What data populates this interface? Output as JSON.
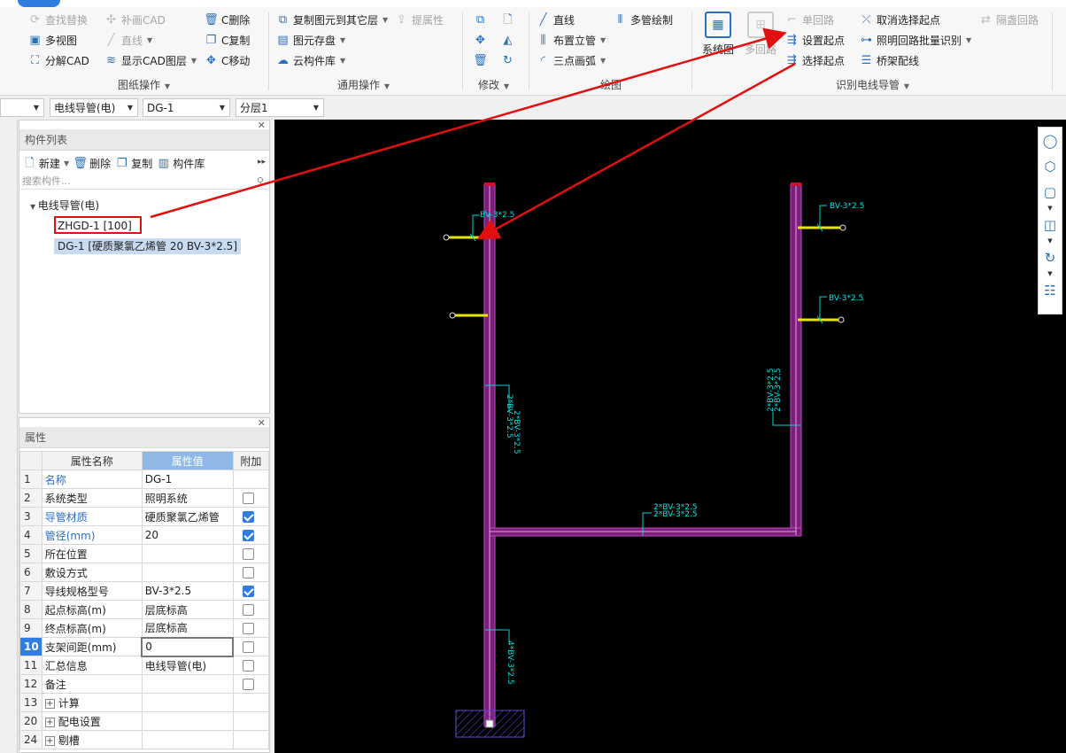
{
  "ribbon": {
    "c1": {
      "find_replace": "查找替换",
      "multi_view": "多视图",
      "explode_cad": "分解CAD"
    },
    "c2": {
      "patch_cad": "补画CAD",
      "line": "直线",
      "show_cad_layer": "显示CAD图层"
    },
    "c3": {
      "c_delete": "C删除",
      "c_copy": "C复制",
      "c_move": "C移动"
    },
    "group_drawing_ops": "图纸操作",
    "c4": {
      "copy_to_other_floor": "复制图元到其它层",
      "extract_attr": "提属性",
      "elem_save": "图元存盘",
      "cloud_lib": "云构件库"
    },
    "group_general_ops": "通用操作",
    "group_modify": "修改",
    "c6": {
      "line": "直线",
      "riser": "布置立管",
      "arc3": "三点画弧",
      "multi_pipe": "多管绘制"
    },
    "group_draw": "绘图",
    "c7": {
      "system_diagram": "系统图",
      "multi_loop": "多回路",
      "single_loop": "单回路",
      "set_start": "设置起点",
      "select_start": "选择起点",
      "cancel_select_start": "取消选择起点",
      "batch_identify": "照明回路批量识别",
      "tray_wire": "桥架配线",
      "floor_loop": "隔盏回路"
    },
    "group_identify": "识别电线导管"
  },
  "selectors": {
    "type": "电线导管(电)",
    "name": "DG-1",
    "layer": "分层1"
  },
  "component_list": {
    "title": "构件列表",
    "toolbar": {
      "new": "新建",
      "delete": "删除",
      "copy": "复制",
      "library": "构件库"
    },
    "search_placeholder": "搜索构件...",
    "tree_root": "电线导管(电)",
    "items": [
      "ZHGD-1 [100]",
      "DG-1 [硬质聚氯乙烯管 20 BV-3*2.5]"
    ]
  },
  "properties": {
    "title": "属性",
    "headers": [
      "属性名称",
      "属性值",
      "附加"
    ],
    "rows": [
      {
        "num": "1",
        "name": "名称",
        "value": "DG-1",
        "check": "none",
        "blue": true
      },
      {
        "num": "2",
        "name": "系统类型",
        "value": "照明系统",
        "check": "off",
        "blue": false
      },
      {
        "num": "3",
        "name": "导管材质",
        "value": "硬质聚氯乙烯管",
        "check": "on",
        "blue": true
      },
      {
        "num": "4",
        "name": "管径(mm)",
        "value": "20",
        "check": "on",
        "blue": true
      },
      {
        "num": "5",
        "name": "所在位置",
        "value": "",
        "check": "off",
        "blue": false
      },
      {
        "num": "6",
        "name": "敷设方式",
        "value": "",
        "check": "off",
        "blue": false
      },
      {
        "num": "7",
        "name": "导线规格型号",
        "value": "BV-3*2.5",
        "check": "on",
        "blue": false
      },
      {
        "num": "8",
        "name": "起点标高(m)",
        "value": "层底标高",
        "check": "off",
        "blue": false
      },
      {
        "num": "9",
        "name": "终点标高(m)",
        "value": "层底标高",
        "check": "off",
        "blue": false
      },
      {
        "num": "10",
        "name": "支架间距(mm)",
        "value": "0",
        "check": "off",
        "blue": false
      },
      {
        "num": "11",
        "name": "汇总信息",
        "value": "电线导管(电)",
        "check": "off",
        "blue": false
      },
      {
        "num": "12",
        "name": "备注",
        "value": "",
        "check": "off",
        "blue": false
      },
      {
        "num": "13",
        "name": "计算",
        "value": "",
        "check": "none",
        "blue": false,
        "expand": true
      },
      {
        "num": "20",
        "name": "配电设置",
        "value": "",
        "check": "none",
        "blue": false,
        "expand": true
      },
      {
        "num": "24",
        "name": "剔槽",
        "value": "",
        "check": "none",
        "blue": false,
        "expand": true
      }
    ]
  },
  "canvas": {
    "labels": {
      "l1": "BV-3*2.5",
      "l2": "BV-3*2.5",
      "l3": "BV-3*2.5",
      "v1a": "2*BV-3*2.5",
      "v1b": "2*BV-3*2.5",
      "v2a": "2*BV-3*2.5",
      "v2b": "2*BV-3*2.5",
      "h1a": "2*BV-3*2.5",
      "h1b": "2*BV-3*2.5",
      "v3": "4*BV-3*2.5"
    },
    "colors": {
      "pipe": "#8b2a8b",
      "pipe_edge": "#c24bc2",
      "wire": "#e6e600",
      "label": "#00e5e5",
      "arrow": "#e01010"
    }
  },
  "view_tools": [
    "orbit-icon",
    "3d-view-icon",
    "box-view-icon",
    "top-view-icon",
    "rotate-icon",
    "properties-view-icon"
  ]
}
